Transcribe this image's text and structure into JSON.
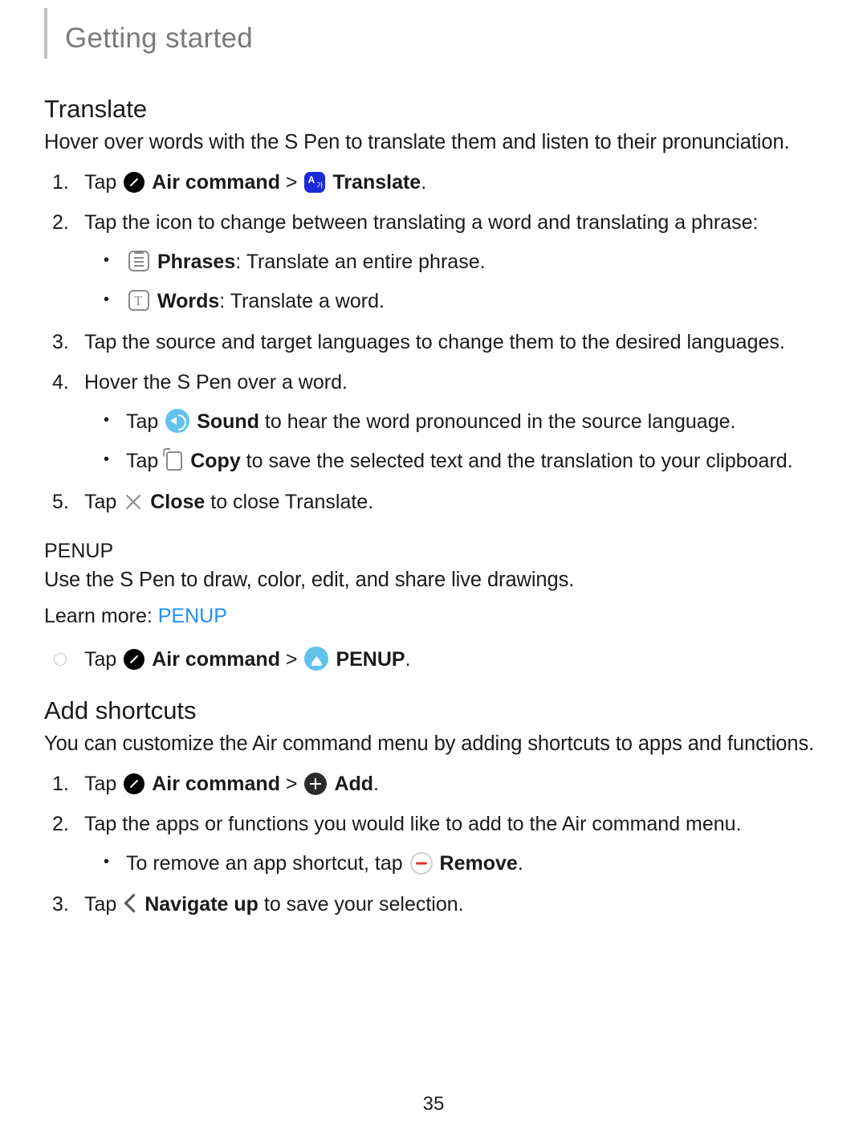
{
  "header": "Getting started",
  "page_number": "35",
  "translate": {
    "heading": "Translate",
    "intro": "Hover over words with the S Pen to translate them and listen to their pronunciation.",
    "step1_prefix": "Tap ",
    "air_command": "Air command",
    "sep": " > ",
    "translate_label": "Translate",
    "period": ".",
    "step2": "Tap the icon to change between translating a word and translating a phrase:",
    "phrases_label": "Phrases",
    "phrases_desc": ": Translate an entire phrase.",
    "words_label": "Words",
    "words_desc": ": Translate a word.",
    "step3": "Tap the source and target languages to change them to the desired languages.",
    "step4": "Hover the S Pen over a word.",
    "sound_prefix": "Tap ",
    "sound_label": "Sound",
    "sound_desc": " to hear the word pronounced in the source language.",
    "copy_prefix": "Tap ",
    "copy_label": "Copy",
    "copy_desc": " to save the selected text and the translation to your clipboard.",
    "step5_prefix": "Tap ",
    "close_label": "Close",
    "step5_desc": " to close Translate."
  },
  "penup": {
    "heading": "PENUP",
    "intro": "Use the S Pen to draw, color, edit, and share live drawings.",
    "learn_prefix": "Learn more: ",
    "learn_link": "PENUP",
    "step_prefix": "Tap ",
    "air_command": "Air command",
    "sep": " > ",
    "penup_label": "PENUP",
    "period": "."
  },
  "shortcuts": {
    "heading": "Add shortcuts",
    "intro": "You can customize the Air command menu by adding shortcuts to apps and functions.",
    "step1_prefix": "Tap ",
    "air_command": "Air command",
    "sep": " > ",
    "add_label": "Add",
    "period": ".",
    "step2": "Tap the apps or functions you would like to add to the Air command menu.",
    "remove_prefix": "To remove an app shortcut, tap ",
    "remove_label": "Remove",
    "step3_prefix": "Tap ",
    "navup_label": "Navigate up",
    "step3_desc": " to save your selection."
  }
}
